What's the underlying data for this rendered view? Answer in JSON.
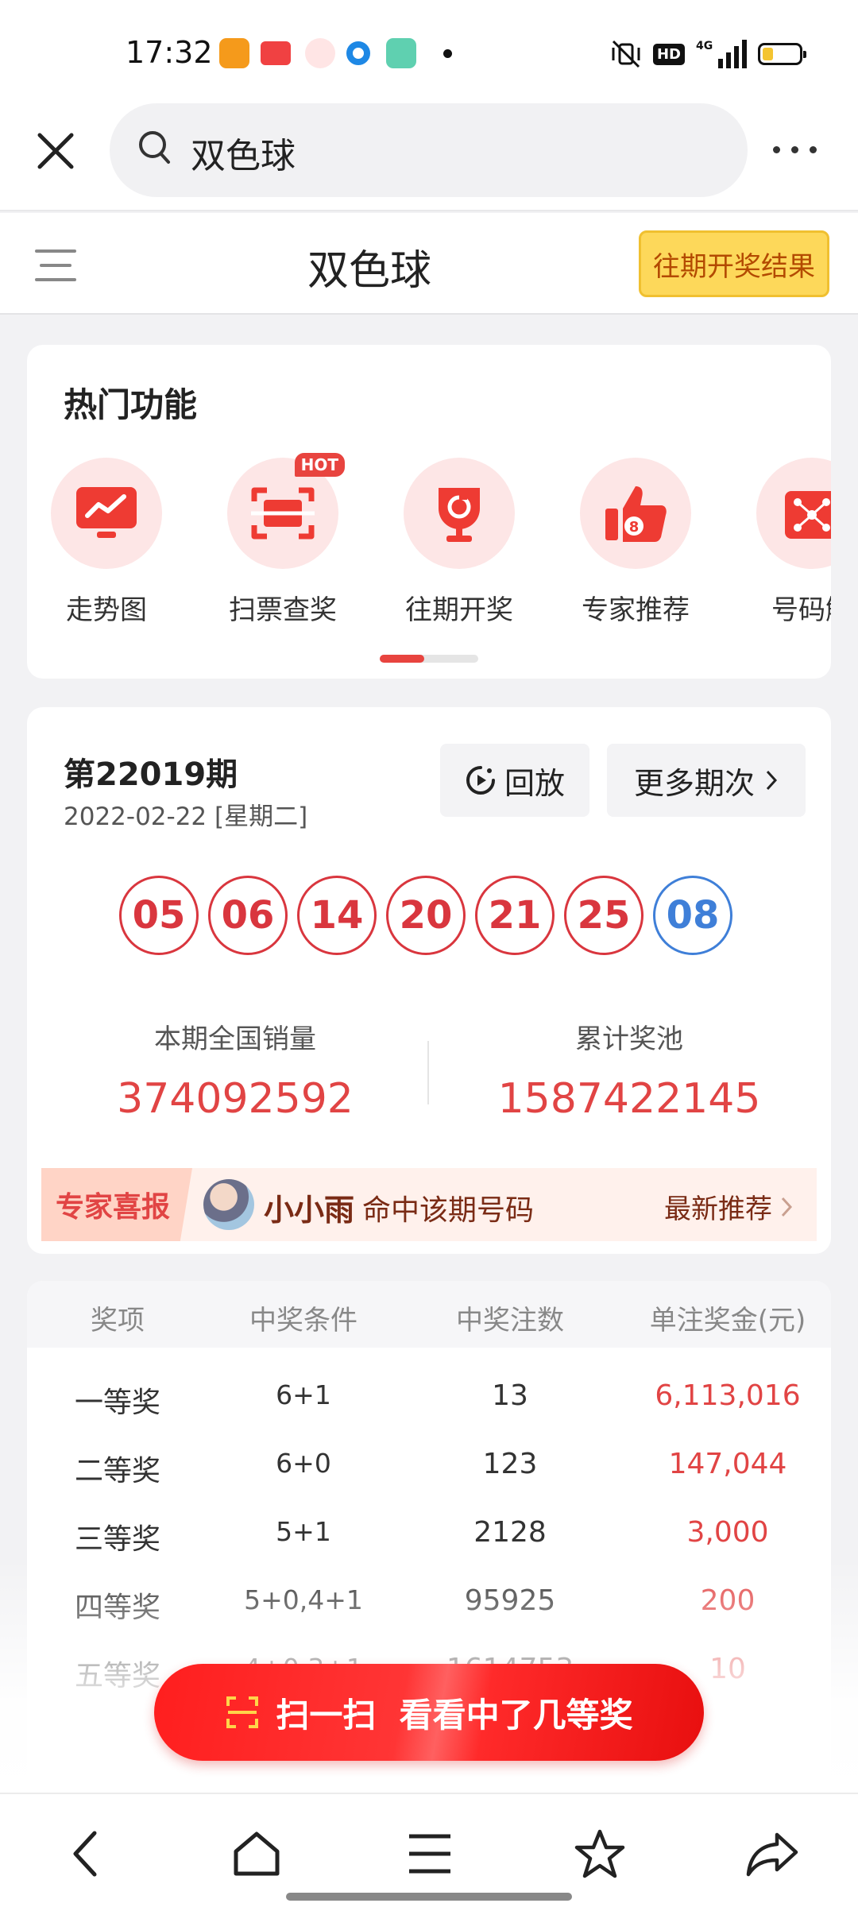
{
  "status_bar": {
    "time": "17:32",
    "app_icons": [
      "fang-app-icon",
      "toutiao-app-icon",
      "map-app-icon",
      "browser-app-icon",
      "gallery-app-icon"
    ],
    "hd_label": "HD",
    "network": "4G",
    "battery_level": 0.3
  },
  "search": {
    "query": "双色球"
  },
  "header": {
    "title": "双色球",
    "history_button": "往期开奖结果"
  },
  "hot_features": {
    "title": "热门功能",
    "items": [
      {
        "label": "走势图",
        "icon": "trend-chart-icon"
      },
      {
        "label": "扫票查奖",
        "icon": "scan-ticket-icon",
        "badge": "HOT"
      },
      {
        "label": "往期开奖",
        "icon": "trophy-icon"
      },
      {
        "label": "专家推荐",
        "icon": "thumbs-up-icon"
      },
      {
        "label": "号码解",
        "icon": "number-analysis-icon"
      }
    ],
    "scroll_position": 0.45
  },
  "draw": {
    "issue": "第22019期",
    "date": "2022-02-22 [星期二]",
    "replay_button": "回放",
    "more_issues_button": "更多期次",
    "red_balls": [
      "05",
      "06",
      "14",
      "20",
      "21",
      "25"
    ],
    "blue_ball": "08",
    "sales_label": "本期全国销量",
    "sales_value": "374092592",
    "pool_label": "累计奖池",
    "pool_value": "1587422145"
  },
  "expert": {
    "tag": "专家喜报",
    "name": "小小雨",
    "text": "命中该期号码",
    "link": "最新推荐"
  },
  "prizes": {
    "headers": [
      "奖项",
      "中奖条件",
      "中奖注数",
      "单注奖金(元)"
    ],
    "rows": [
      {
        "level": "一等奖",
        "condition": "6+1",
        "count": "13",
        "amount": "6,113,016"
      },
      {
        "level": "二等奖",
        "condition": "6+0",
        "count": "123",
        "amount": "147,044"
      },
      {
        "level": "三等奖",
        "condition": "5+1",
        "count": "2128",
        "amount": "3,000"
      },
      {
        "level": "四等奖",
        "condition": "5+0,4+1",
        "count": "95925",
        "amount": "200"
      },
      {
        "level": "五等奖",
        "condition": "4+0,3+1",
        "count": "1614753",
        "amount": "10"
      }
    ]
  },
  "scan_button": "扫一扫  看看中了几等奖",
  "colors": {
    "accent_red": "#e14444",
    "ball_red": "#d9363e",
    "ball_blue": "#3f7fd8",
    "history_button_bg": "#fdd85a"
  }
}
